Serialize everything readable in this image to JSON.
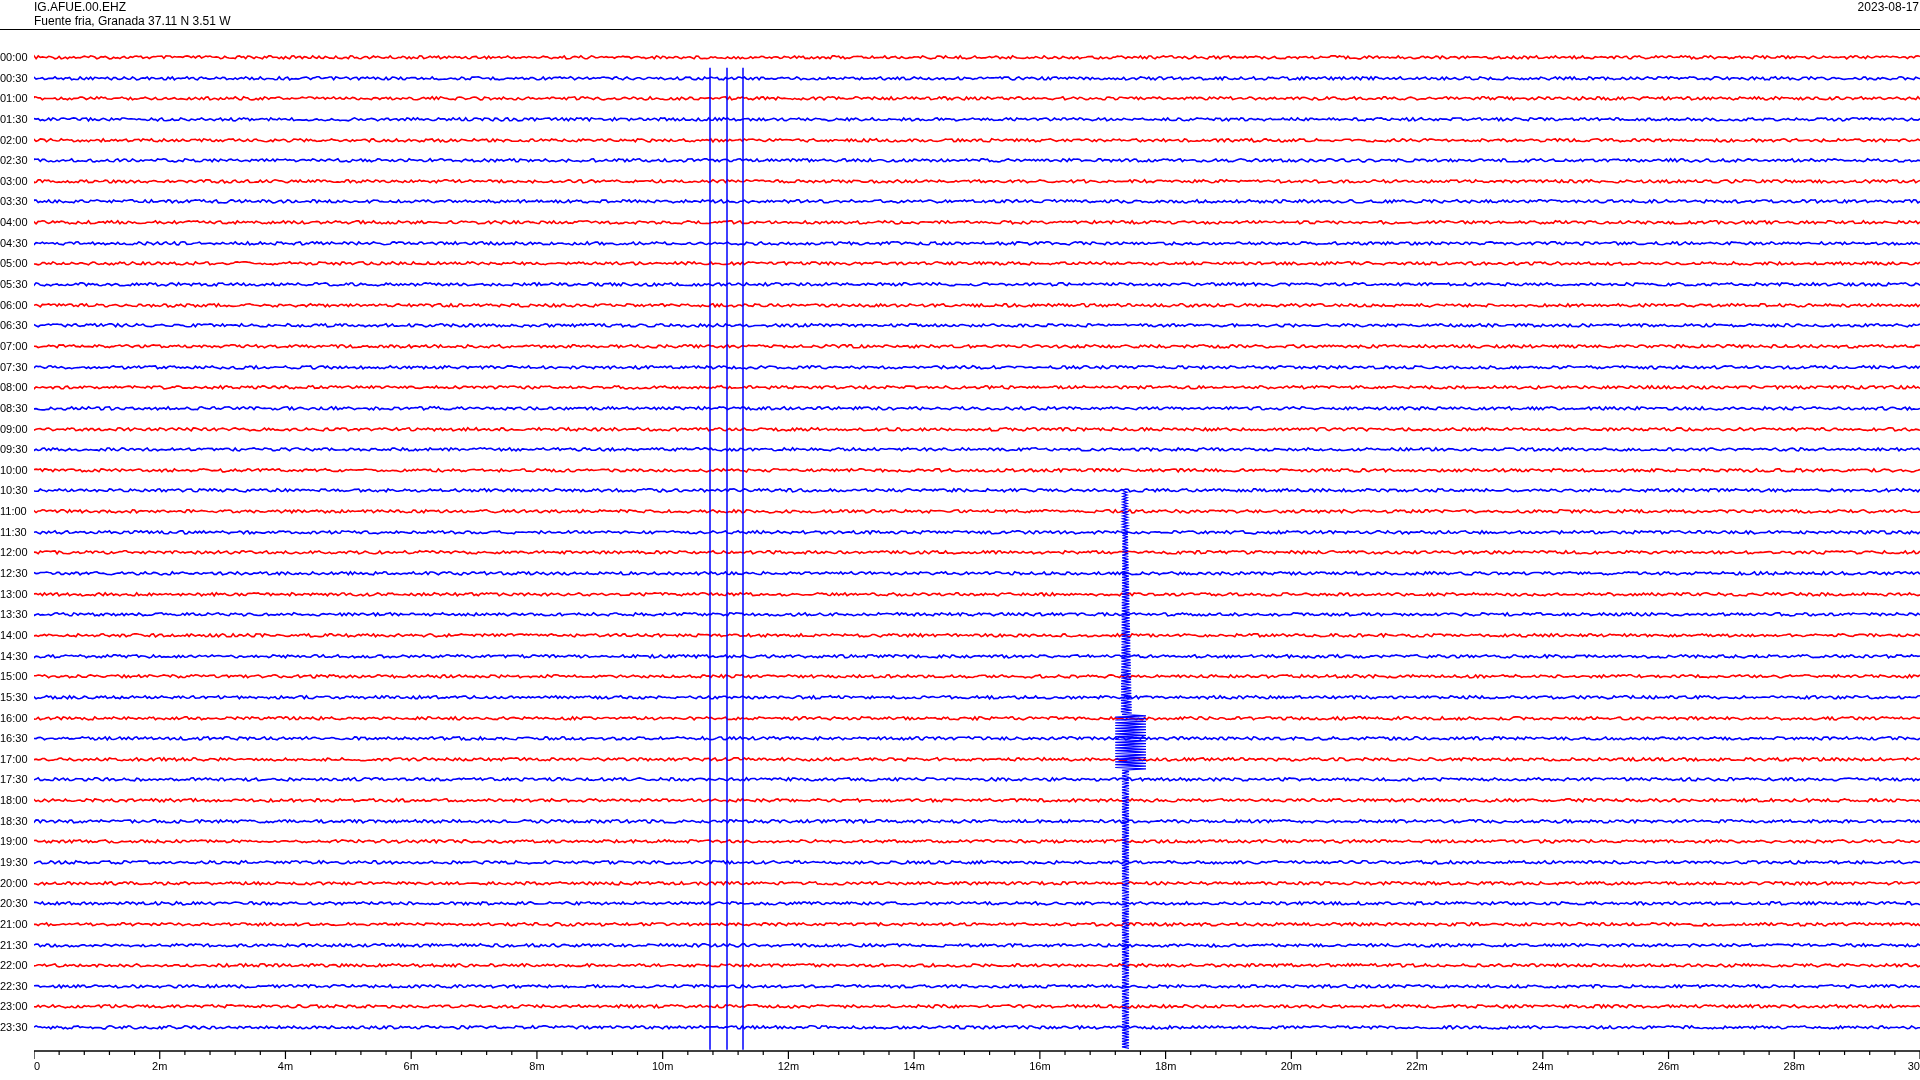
{
  "header": {
    "station": "IG.AFUE.00.EHZ",
    "location": "Fuente fria, Granada  37.11 N 3.51 W",
    "date": "2023-08-17"
  },
  "rows": [
    {
      "time": "00:00",
      "color": "#ff0000"
    },
    {
      "time": "00:30",
      "color": "#0000ff"
    },
    {
      "time": "01:00",
      "color": "#ff0000"
    },
    {
      "time": "01:30",
      "color": "#0000ff"
    },
    {
      "time": "02:00",
      "color": "#ff0000"
    },
    {
      "time": "02:30",
      "color": "#0000ff"
    },
    {
      "time": "03:00",
      "color": "#ff0000"
    },
    {
      "time": "03:30",
      "color": "#0000ff"
    },
    {
      "time": "04:00",
      "color": "#ff0000"
    },
    {
      "time": "04:30",
      "color": "#0000ff"
    },
    {
      "time": "05:00",
      "color": "#ff0000"
    },
    {
      "time": "05:30",
      "color": "#0000ff"
    },
    {
      "time": "06:00",
      "color": "#ff0000"
    },
    {
      "time": "06:30",
      "color": "#0000ff"
    },
    {
      "time": "07:00",
      "color": "#ff0000"
    },
    {
      "time": "07:30",
      "color": "#0000ff"
    },
    {
      "time": "08:00",
      "color": "#ff0000"
    },
    {
      "time": "08:30",
      "color": "#0000ff"
    },
    {
      "time": "09:00",
      "color": "#ff0000"
    },
    {
      "time": "09:30",
      "color": "#0000ff"
    },
    {
      "time": "10:00",
      "color": "#ff0000"
    },
    {
      "time": "10:30",
      "color": "#0000ff"
    },
    {
      "time": "11:00",
      "color": "#ff0000"
    },
    {
      "time": "11:30",
      "color": "#0000ff"
    },
    {
      "time": "12:00",
      "color": "#ff0000"
    },
    {
      "time": "12:30",
      "color": "#0000ff"
    },
    {
      "time": "13:00",
      "color": "#ff0000"
    },
    {
      "time": "13:30",
      "color": "#0000ff"
    },
    {
      "time": "14:00",
      "color": "#ff0000"
    },
    {
      "time": "14:30",
      "color": "#0000ff"
    },
    {
      "time": "15:00",
      "color": "#ff0000"
    },
    {
      "time": "15:30",
      "color": "#0000ff"
    },
    {
      "time": "16:00",
      "color": "#ff0000"
    },
    {
      "time": "16:30",
      "color": "#0000ff"
    },
    {
      "time": "17:00",
      "color": "#ff0000"
    },
    {
      "time": "17:30",
      "color": "#0000ff"
    },
    {
      "time": "18:00",
      "color": "#ff0000"
    },
    {
      "time": "18:30",
      "color": "#0000ff"
    },
    {
      "time": "19:00",
      "color": "#ff0000"
    },
    {
      "time": "19:30",
      "color": "#0000ff"
    },
    {
      "time": "20:00",
      "color": "#ff0000"
    },
    {
      "time": "20:30",
      "color": "#0000ff"
    },
    {
      "time": "21:00",
      "color": "#ff0000"
    },
    {
      "time": "21:30",
      "color": "#0000ff"
    },
    {
      "time": "22:00",
      "color": "#ff0000"
    },
    {
      "time": "22:30",
      "color": "#0000ff"
    },
    {
      "time": "23:00",
      "color": "#ff0000"
    },
    {
      "time": "23:30",
      "color": "#0000ff"
    }
  ],
  "x_axis": {
    "labels": [
      "0",
      "2m",
      "4m",
      "6m",
      "8m",
      "10m",
      "12m",
      "14m",
      "16m",
      "18m",
      "20m",
      "22m",
      "24m",
      "26m",
      "28m",
      "30"
    ]
  }
}
